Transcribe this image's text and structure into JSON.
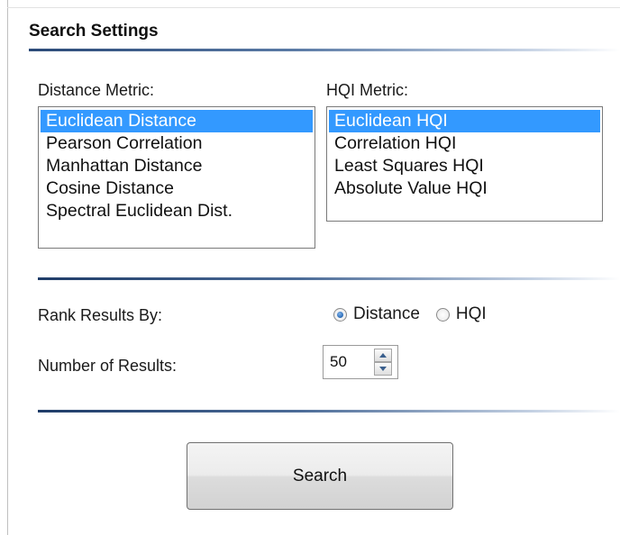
{
  "panel": {
    "title": "Search Settings"
  },
  "distance_metric": {
    "label": "Distance Metric:",
    "items": [
      "Euclidean Distance",
      "Pearson Correlation",
      "Manhattan Distance",
      "Cosine Distance",
      "Spectral Euclidean Dist."
    ],
    "selected": "Euclidean Distance"
  },
  "hqi_metric": {
    "label": "HQI Metric:",
    "items": [
      "Euclidean HQI",
      "Correlation HQI",
      "Least Squares HQI",
      "Absolute Value HQI"
    ],
    "selected": "Euclidean HQI"
  },
  "rank": {
    "label": "Rank Results By:",
    "options": [
      "Distance",
      "HQI"
    ],
    "selected": "Distance"
  },
  "num_results": {
    "label": "Number of Results:",
    "value": "50"
  },
  "search_button": {
    "label": "Search"
  },
  "colors": {
    "selection": "#3399ff",
    "separator": "#1f3c68"
  }
}
